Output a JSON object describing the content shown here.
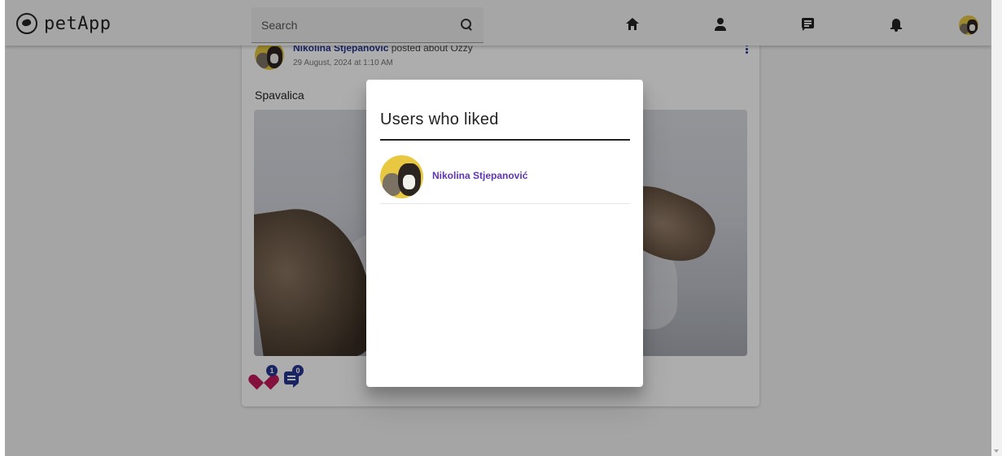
{
  "brand": {
    "name": "petApp",
    "logo_icon": "paw-circle-icon"
  },
  "search": {
    "placeholder": "Search",
    "icon": "search-icon"
  },
  "nav": [
    {
      "name": "home",
      "icon": "home-icon"
    },
    {
      "name": "profile",
      "icon": "person-icon"
    },
    {
      "name": "messages",
      "icon": "chat-icon"
    },
    {
      "name": "notifications",
      "icon": "bell-icon"
    }
  ],
  "post": {
    "author": "Nikolina Stjepanović",
    "action": "posted about",
    "pet": "Ozzy",
    "date": "29 August, 2024 at 1:10 AM",
    "text": "Spavalica",
    "likes": "1",
    "comments": "0"
  },
  "dialog": {
    "title": "Users who liked",
    "users": [
      {
        "name": "Nikolina Stjepanović"
      }
    ]
  },
  "colors": {
    "accent": "#283593",
    "like": "#c2185b",
    "user_link": "#5e35b1",
    "avatar_bg": "#e8c840"
  }
}
